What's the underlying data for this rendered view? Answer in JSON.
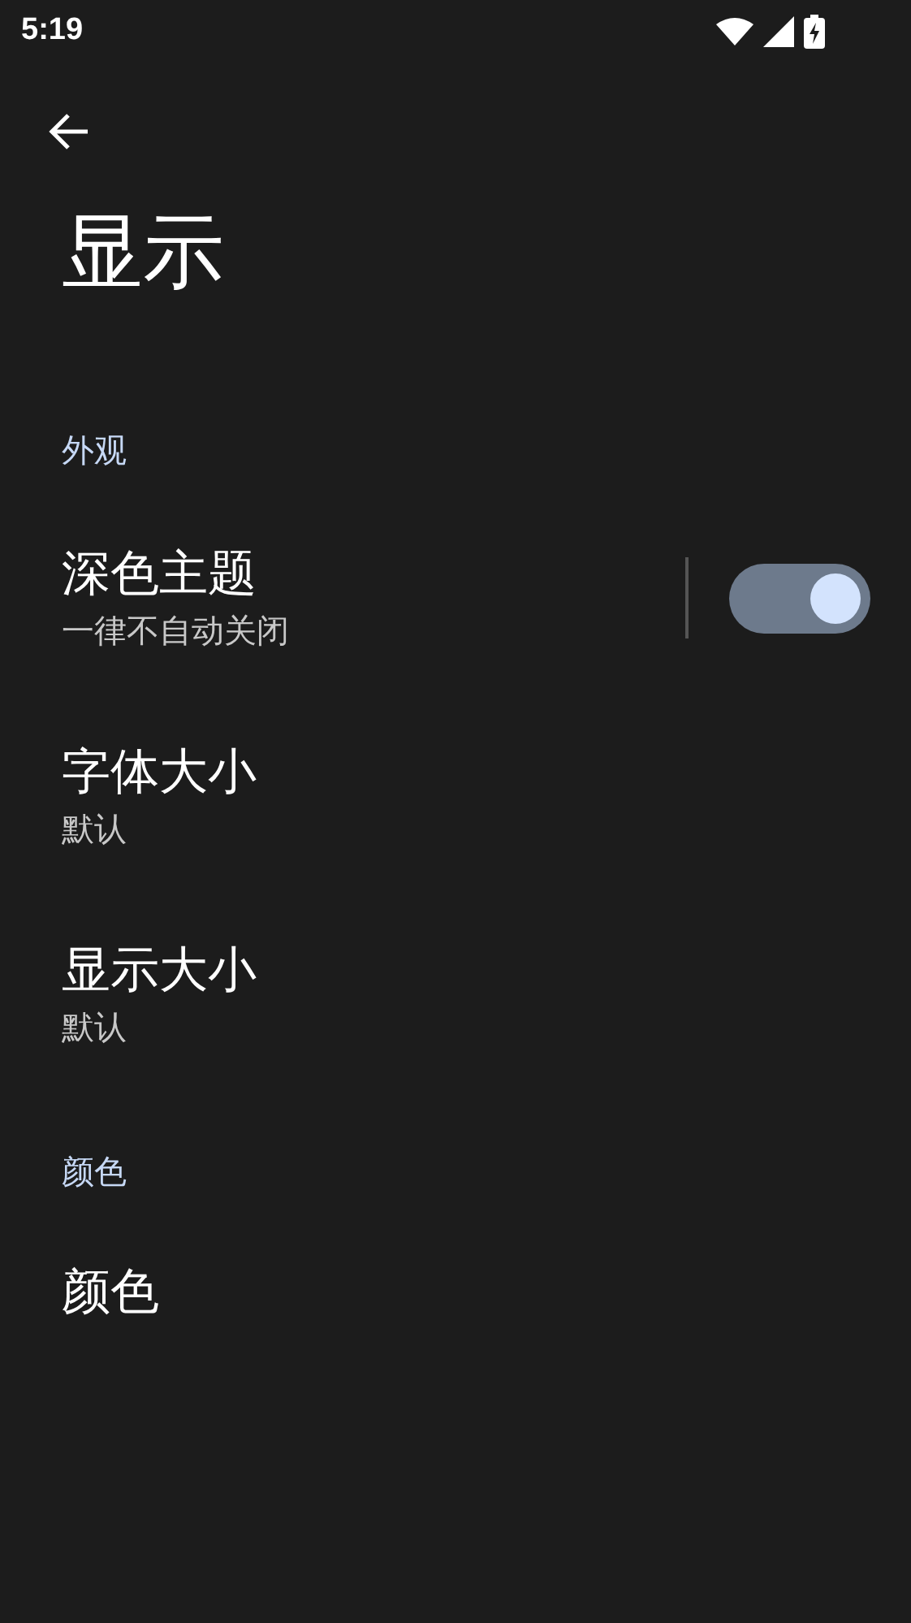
{
  "status_bar": {
    "time": "5:19"
  },
  "title": "显示",
  "sections": [
    {
      "header": "外观",
      "items": [
        {
          "kind": "switch",
          "title": "深色主题",
          "subtitle": "一律不自动关闭",
          "on": true
        },
        {
          "kind": "plain",
          "title": "字体大小",
          "subtitle": "默认"
        },
        {
          "kind": "plain",
          "title": "显示大小",
          "subtitle": "默认"
        }
      ]
    },
    {
      "header": "颜色",
      "items": [
        {
          "kind": "plain",
          "title": "颜色"
        }
      ]
    }
  ]
}
